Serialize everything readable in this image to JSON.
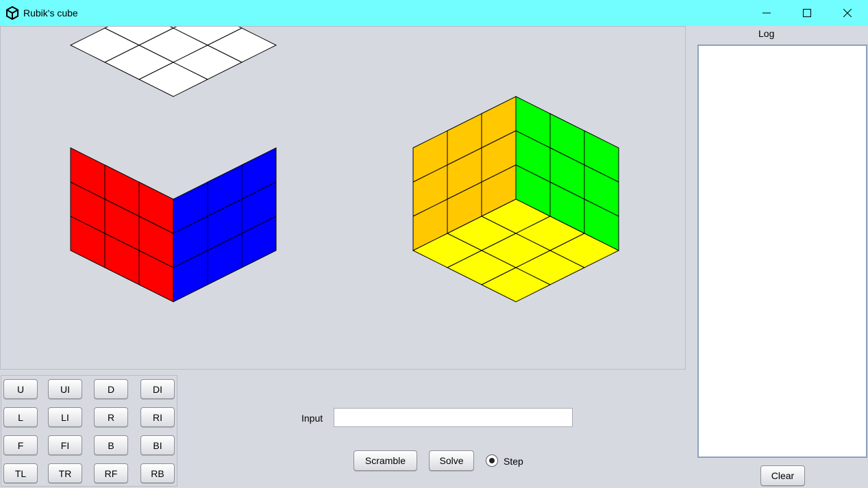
{
  "window": {
    "title": "Rubik's cube",
    "icon": "cube-icon",
    "controls": [
      "minimize-icon",
      "maximize-icon",
      "close-icon"
    ]
  },
  "cube_views": {
    "front_view": {
      "top": "white",
      "left": "red",
      "right": "blue"
    },
    "back_view": {
      "left": "orange",
      "right": "green",
      "bottom": "yellow"
    }
  },
  "colors": {
    "white": "#ffffff",
    "red": "#ff0000",
    "blue": "#0000ff",
    "orange": "#ffc800",
    "green": "#00ff00",
    "yellow": "#ffff00",
    "titlebar": "#72fdfe",
    "panel": "#d6d9e0"
  },
  "moves": [
    [
      "U",
      "UI",
      "D",
      "DI"
    ],
    [
      "L",
      "LI",
      "R",
      "RI"
    ],
    [
      "F",
      "FI",
      "B",
      "BI"
    ],
    [
      "TL",
      "TR",
      "RF",
      "RB"
    ]
  ],
  "input": {
    "label": "Input",
    "value": ""
  },
  "controls": {
    "scramble": "Scramble",
    "solve": "Solve",
    "step": "Step",
    "step_selected": true
  },
  "log": {
    "label": "Log",
    "content": "",
    "clear": "Clear"
  }
}
